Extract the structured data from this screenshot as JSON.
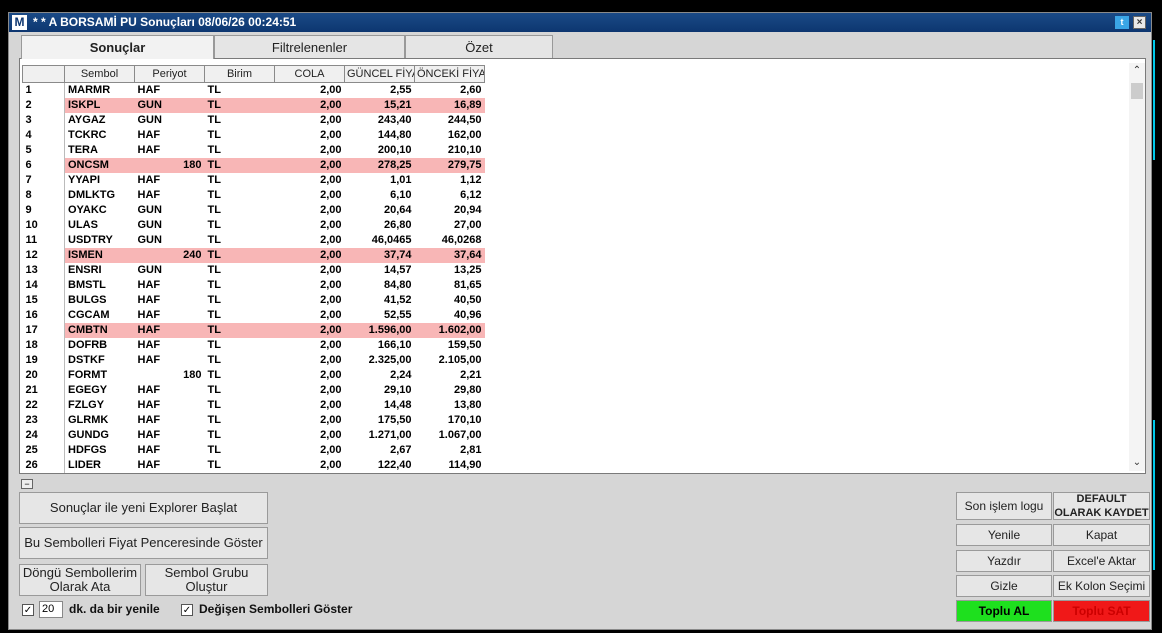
{
  "window": {
    "app_icon": "M",
    "title": "* * A BORSAMİ PU Sonuçları  08/06/26 00:24:51",
    "twitter_icon": "twitter-icon",
    "close_symbol": "×"
  },
  "tabs": [
    "Sonuçlar",
    "Filtrelenenler",
    "Özet"
  ],
  "table": {
    "columns": [
      "",
      "Sembol",
      "Periyot",
      "Birim",
      "COLA",
      "GÜNCEL FİYAT",
      "ÖNCEKİ FİYAT"
    ],
    "rows": [
      {
        "n": "1",
        "sym": "MARMR",
        "per": "HAF",
        "per_right": "",
        "unit": "TL",
        "cola": "2,00",
        "cur": "2,55",
        "prev": "2,60",
        "hl": false
      },
      {
        "n": "2",
        "sym": "ISKPL",
        "per": "GUN",
        "per_right": "",
        "unit": "TL",
        "cola": "2,00",
        "cur": "15,21",
        "prev": "16,89",
        "hl": true
      },
      {
        "n": "3",
        "sym": "AYGAZ",
        "per": "GUN",
        "per_right": "",
        "unit": "TL",
        "cola": "2,00",
        "cur": "243,40",
        "prev": "244,50",
        "hl": false
      },
      {
        "n": "4",
        "sym": "TCKRC",
        "per": "HAF",
        "per_right": "",
        "unit": "TL",
        "cola": "2,00",
        "cur": "144,80",
        "prev": "162,00",
        "hl": false
      },
      {
        "n": "5",
        "sym": "TERA",
        "per": "HAF",
        "per_right": "",
        "unit": "TL",
        "cola": "2,00",
        "cur": "200,10",
        "prev": "210,10",
        "hl": false
      },
      {
        "n": "6",
        "sym": "ONCSM",
        "per": "",
        "per_right": "180",
        "unit": "TL",
        "cola": "2,00",
        "cur": "278,25",
        "prev": "279,75",
        "hl": true
      },
      {
        "n": "7",
        "sym": "YYAPI",
        "per": "HAF",
        "per_right": "",
        "unit": "TL",
        "cola": "2,00",
        "cur": "1,01",
        "prev": "1,12",
        "hl": false
      },
      {
        "n": "8",
        "sym": "DMLKTG",
        "per": "HAF",
        "per_right": "",
        "unit": "TL",
        "cola": "2,00",
        "cur": "6,10",
        "prev": "6,12",
        "hl": false
      },
      {
        "n": "9",
        "sym": "OYAKC",
        "per": "GUN",
        "per_right": "",
        "unit": "TL",
        "cola": "2,00",
        "cur": "20,64",
        "prev": "20,94",
        "hl": false
      },
      {
        "n": "10",
        "sym": "ULAS",
        "per": "GUN",
        "per_right": "",
        "unit": "TL",
        "cola": "2,00",
        "cur": "26,80",
        "prev": "27,00",
        "hl": false
      },
      {
        "n": "11",
        "sym": "USDTRY",
        "per": "GUN",
        "per_right": "",
        "unit": "TL",
        "cola": "2,00",
        "cur": "46,0465",
        "prev": "46,0268",
        "hl": false
      },
      {
        "n": "12",
        "sym": "ISMEN",
        "per": "",
        "per_right": "240",
        "unit": "TL",
        "cola": "2,00",
        "cur": "37,74",
        "prev": "37,64",
        "hl": true
      },
      {
        "n": "13",
        "sym": "ENSRI",
        "per": "GUN",
        "per_right": "",
        "unit": "TL",
        "cola": "2,00",
        "cur": "14,57",
        "prev": "13,25",
        "hl": false
      },
      {
        "n": "14",
        "sym": "BMSTL",
        "per": "HAF",
        "per_right": "",
        "unit": "TL",
        "cola": "2,00",
        "cur": "84,80",
        "prev": "81,65",
        "hl": false
      },
      {
        "n": "15",
        "sym": "BULGS",
        "per": "HAF",
        "per_right": "",
        "unit": "TL",
        "cola": "2,00",
        "cur": "41,52",
        "prev": "40,50",
        "hl": false
      },
      {
        "n": "16",
        "sym": "CGCAM",
        "per": "HAF",
        "per_right": "",
        "unit": "TL",
        "cola": "2,00",
        "cur": "52,55",
        "prev": "40,96",
        "hl": false
      },
      {
        "n": "17",
        "sym": "CMBTN",
        "per": "HAF",
        "per_right": "",
        "unit": "TL",
        "cola": "2,00",
        "cur": "1.596,00",
        "prev": "1.602,00",
        "hl": true
      },
      {
        "n": "18",
        "sym": "DOFRB",
        "per": "HAF",
        "per_right": "",
        "unit": "TL",
        "cola": "2,00",
        "cur": "166,10",
        "prev": "159,50",
        "hl": false
      },
      {
        "n": "19",
        "sym": "DSTKF",
        "per": "HAF",
        "per_right": "",
        "unit": "TL",
        "cola": "2,00",
        "cur": "2.325,00",
        "prev": "2.105,00",
        "hl": false
      },
      {
        "n": "20",
        "sym": "FORMT",
        "per": "",
        "per_right": "180",
        "unit": "TL",
        "cola": "2,00",
        "cur": "2,24",
        "prev": "2,21",
        "hl": false
      },
      {
        "n": "21",
        "sym": "EGEGY",
        "per": "HAF",
        "per_right": "",
        "unit": "TL",
        "cola": "2,00",
        "cur": "29,10",
        "prev": "29,80",
        "hl": false
      },
      {
        "n": "22",
        "sym": "FZLGY",
        "per": "HAF",
        "per_right": "",
        "unit": "TL",
        "cola": "2,00",
        "cur": "14,48",
        "prev": "13,80",
        "hl": false
      },
      {
        "n": "23",
        "sym": "GLRMK",
        "per": "HAF",
        "per_right": "",
        "unit": "TL",
        "cola": "2,00",
        "cur": "175,50",
        "prev": "170,10",
        "hl": false
      },
      {
        "n": "24",
        "sym": "GUNDG",
        "per": "HAF",
        "per_right": "",
        "unit": "TL",
        "cola": "2,00",
        "cur": "1.271,00",
        "prev": "1.067,00",
        "hl": false
      },
      {
        "n": "25",
        "sym": "HDFGS",
        "per": "HAF",
        "per_right": "",
        "unit": "TL",
        "cola": "2,00",
        "cur": "2,67",
        "prev": "2,81",
        "hl": false
      },
      {
        "n": "26",
        "sym": "LIDER",
        "per": "HAF",
        "per_right": "",
        "unit": "TL",
        "cola": "2,00",
        "cur": "122,40",
        "prev": "114,90",
        "hl": false
      }
    ]
  },
  "scroll": {
    "up": "⌃",
    "down": "⌄"
  },
  "collapse_symbol": "−",
  "buttons": {
    "explorer": "Sonuçlar ile yeni Explorer Başlat",
    "price_window": "Bu Sembolleri Fiyat Penceresinde Göster",
    "loop_symbols": "Döngü Sembollerim Olarak Ata",
    "symbol_group": "Sembol Grubu Oluştur",
    "last_log": "Son işlem logu",
    "default_save": "DEFAULT OLARAK KAYDET",
    "refresh": "Yenile",
    "close": "Kapat",
    "print": "Yazdır",
    "excel": "Excel'e Aktar",
    "hide": "Gizle",
    "extra_column": "Ek Kolon Seçimi",
    "buy_all": "Toplu AL",
    "sell_all": "Toplu SAT"
  },
  "refresh_option": {
    "checked": "✓",
    "minutes": "20",
    "label": "dk. da bir yenile"
  },
  "changed_option": {
    "checked": "✓",
    "label": "Değişen Sembolleri Göster"
  }
}
